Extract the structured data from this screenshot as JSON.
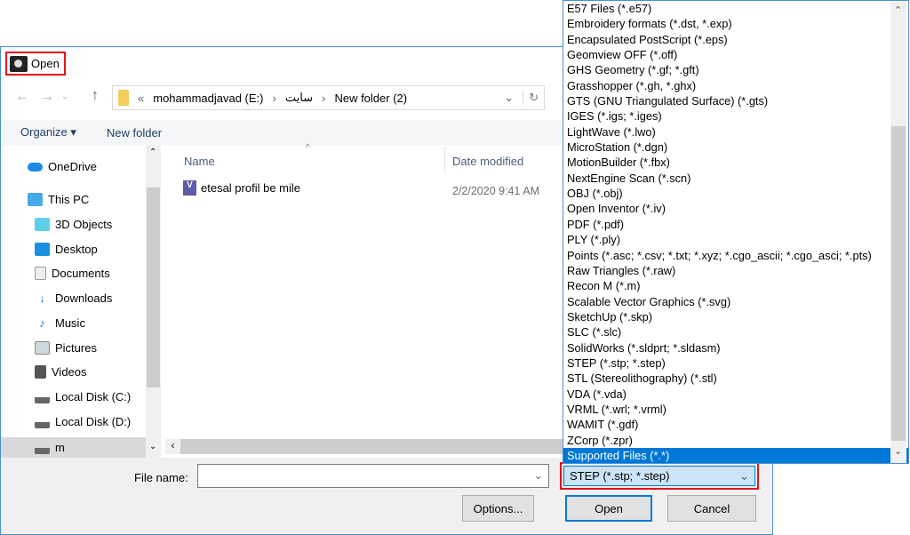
{
  "window": {
    "title": "Open"
  },
  "address": {
    "overflow": "«",
    "segments": [
      "mohammadjavad (E:)",
      "سایت",
      "New folder (2)"
    ]
  },
  "toolbar": {
    "organize": "Organize ▾",
    "new_folder": "New folder"
  },
  "sidebar": {
    "items": [
      {
        "label": "OneDrive",
        "icon": "cloud-icon"
      },
      {
        "label": "This PC",
        "icon": "computer-icon"
      },
      {
        "label": "3D Objects",
        "icon": "cube-icon"
      },
      {
        "label": "Desktop",
        "icon": "desktop-icon"
      },
      {
        "label": "Documents",
        "icon": "document-icon"
      },
      {
        "label": "Downloads",
        "icon": "download-icon"
      },
      {
        "label": "Music",
        "icon": "music-icon"
      },
      {
        "label": "Pictures",
        "icon": "pictures-icon"
      },
      {
        "label": "Videos",
        "icon": "videos-icon"
      },
      {
        "label": "Local Disk (C:)",
        "icon": "drive-icon"
      },
      {
        "label": "Local Disk (D:)",
        "icon": "drive-icon"
      },
      {
        "label": "m",
        "icon": "drive-icon"
      }
    ]
  },
  "filelist": {
    "columns": [
      "Name",
      "Date modified"
    ],
    "rows": [
      {
        "name": "etesal profil be mile",
        "date": "2/2/2020 9:41 AM"
      }
    ]
  },
  "bottom": {
    "file_name_label": "File name:",
    "file_name_value": "",
    "filter_value": "STEP (*.stp; *.step)",
    "options": "Options...",
    "open": "Open",
    "cancel": "Cancel"
  },
  "dropdown": {
    "selected": "Supported Files (*.*)",
    "options": [
      "E57 Files (*.e57)",
      "Embroidery formats (*.dst, *.exp)",
      "Encapsulated PostScript (*.eps)",
      "Geomview OFF (*.off)",
      "GHS Geometry (*.gf; *.gft)",
      "Grasshopper (*.gh, *.ghx)",
      "GTS (GNU Triangulated Surface) (*.gts)",
      "IGES (*.igs; *.iges)",
      "LightWave (*.lwo)",
      "MicroStation (*.dgn)",
      "MotionBuilder (*.fbx)",
      "NextEngine Scan (*.scn)",
      "OBJ (*.obj)",
      "Open Inventor (*.iv)",
      "PDF (*.pdf)",
      "PLY (*.ply)",
      "Points (*.asc; *.csv; *.txt; *.xyz; *.cgo_ascii; *.cgo_asci; *.pts)",
      "Raw Triangles (*.raw)",
      "Recon M (*.m)",
      "Scalable Vector Graphics (*.svg)",
      "SketchUp (*.skp)",
      "SLC (*.slc)",
      "SolidWorks (*.sldprt; *.sldasm)",
      "STEP (*.stp; *.step)",
      "STL (Stereolithography) (*.stl)",
      "VDA (*.vda)",
      "VRML (*.wrl; *.vrml)",
      "WAMIT (*.gdf)",
      "ZCorp (*.zpr)",
      "Supported Files (*.*)"
    ]
  },
  "colors": {
    "accent": "#0078d7",
    "highlight": "#e0141e"
  }
}
